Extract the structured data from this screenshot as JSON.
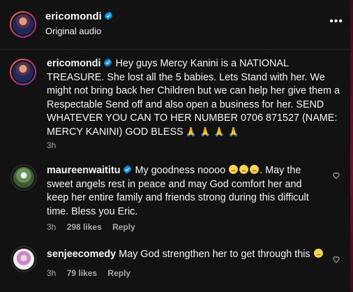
{
  "header": {
    "username": "ericomondi",
    "audio_label": "Original audio",
    "more_label": "•••"
  },
  "caption": {
    "username": "ericomondi",
    "text": "Hey guys Mercy Kanini is a NATIONAL TREASURE. She lost all the 5 babies. Lets Stand with her. We might not bring back her Children but we can help her give them a Respectable Send off and also open a business for her. SEND WHATEVER YOU CAN TO HER NUMBER 0706 871527 (NAME: MERCY KANINI) GOD BLESS",
    "emoji": "🙏 🙏 🙏 🙏",
    "time": "3h"
  },
  "comments": [
    {
      "username": "maureenwaititu",
      "text_start": "My goodness noooo",
      "text_end": ". May the sweet angels rest in peace and may God comfort her and keep her entire family and friends strong during this difficult time. Bless you Eric.",
      "time": "3h",
      "likes": "298 likes",
      "reply": "Reply"
    },
    {
      "username": "senjeecomedy",
      "text": "May God strengthen her to get through this",
      "time": "3h",
      "likes": "79 likes",
      "reply": "Reply"
    }
  ],
  "colors": {
    "background": "#121212",
    "text": "#f5f5f5",
    "muted": "#a8a8a8",
    "verified": "#0095f6"
  }
}
